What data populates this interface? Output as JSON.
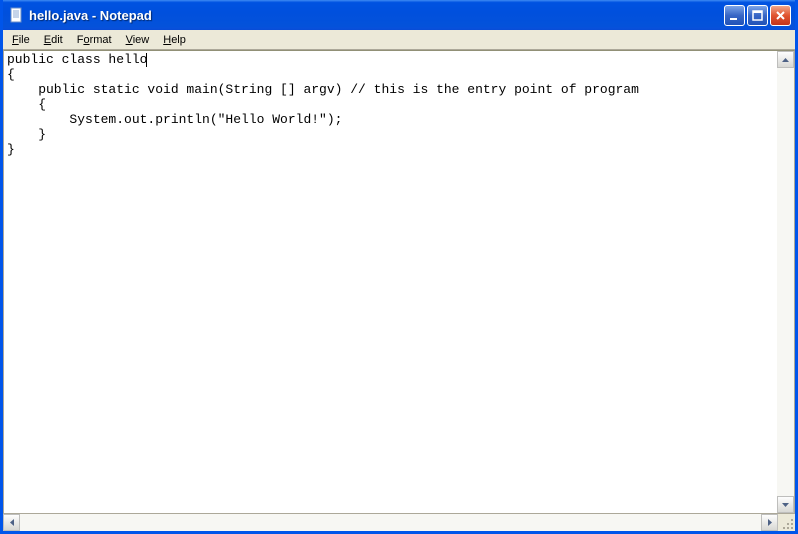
{
  "window": {
    "title": "hello.java - Notepad"
  },
  "menubar": {
    "items": [
      {
        "label": "File",
        "accel": "F"
      },
      {
        "label": "Edit",
        "accel": "E"
      },
      {
        "label": "Format",
        "accel": "o"
      },
      {
        "label": "View",
        "accel": "V"
      },
      {
        "label": "Help",
        "accel": "H"
      }
    ]
  },
  "editor": {
    "lines": [
      "public class hello",
      "{",
      "    public static void main(String [] argv) // this is the entry point of program",
      "    {",
      "        System.out.println(\"Hello World!\");",
      "    }",
      "}"
    ],
    "cursor_line": 0,
    "cursor_col": 18
  }
}
